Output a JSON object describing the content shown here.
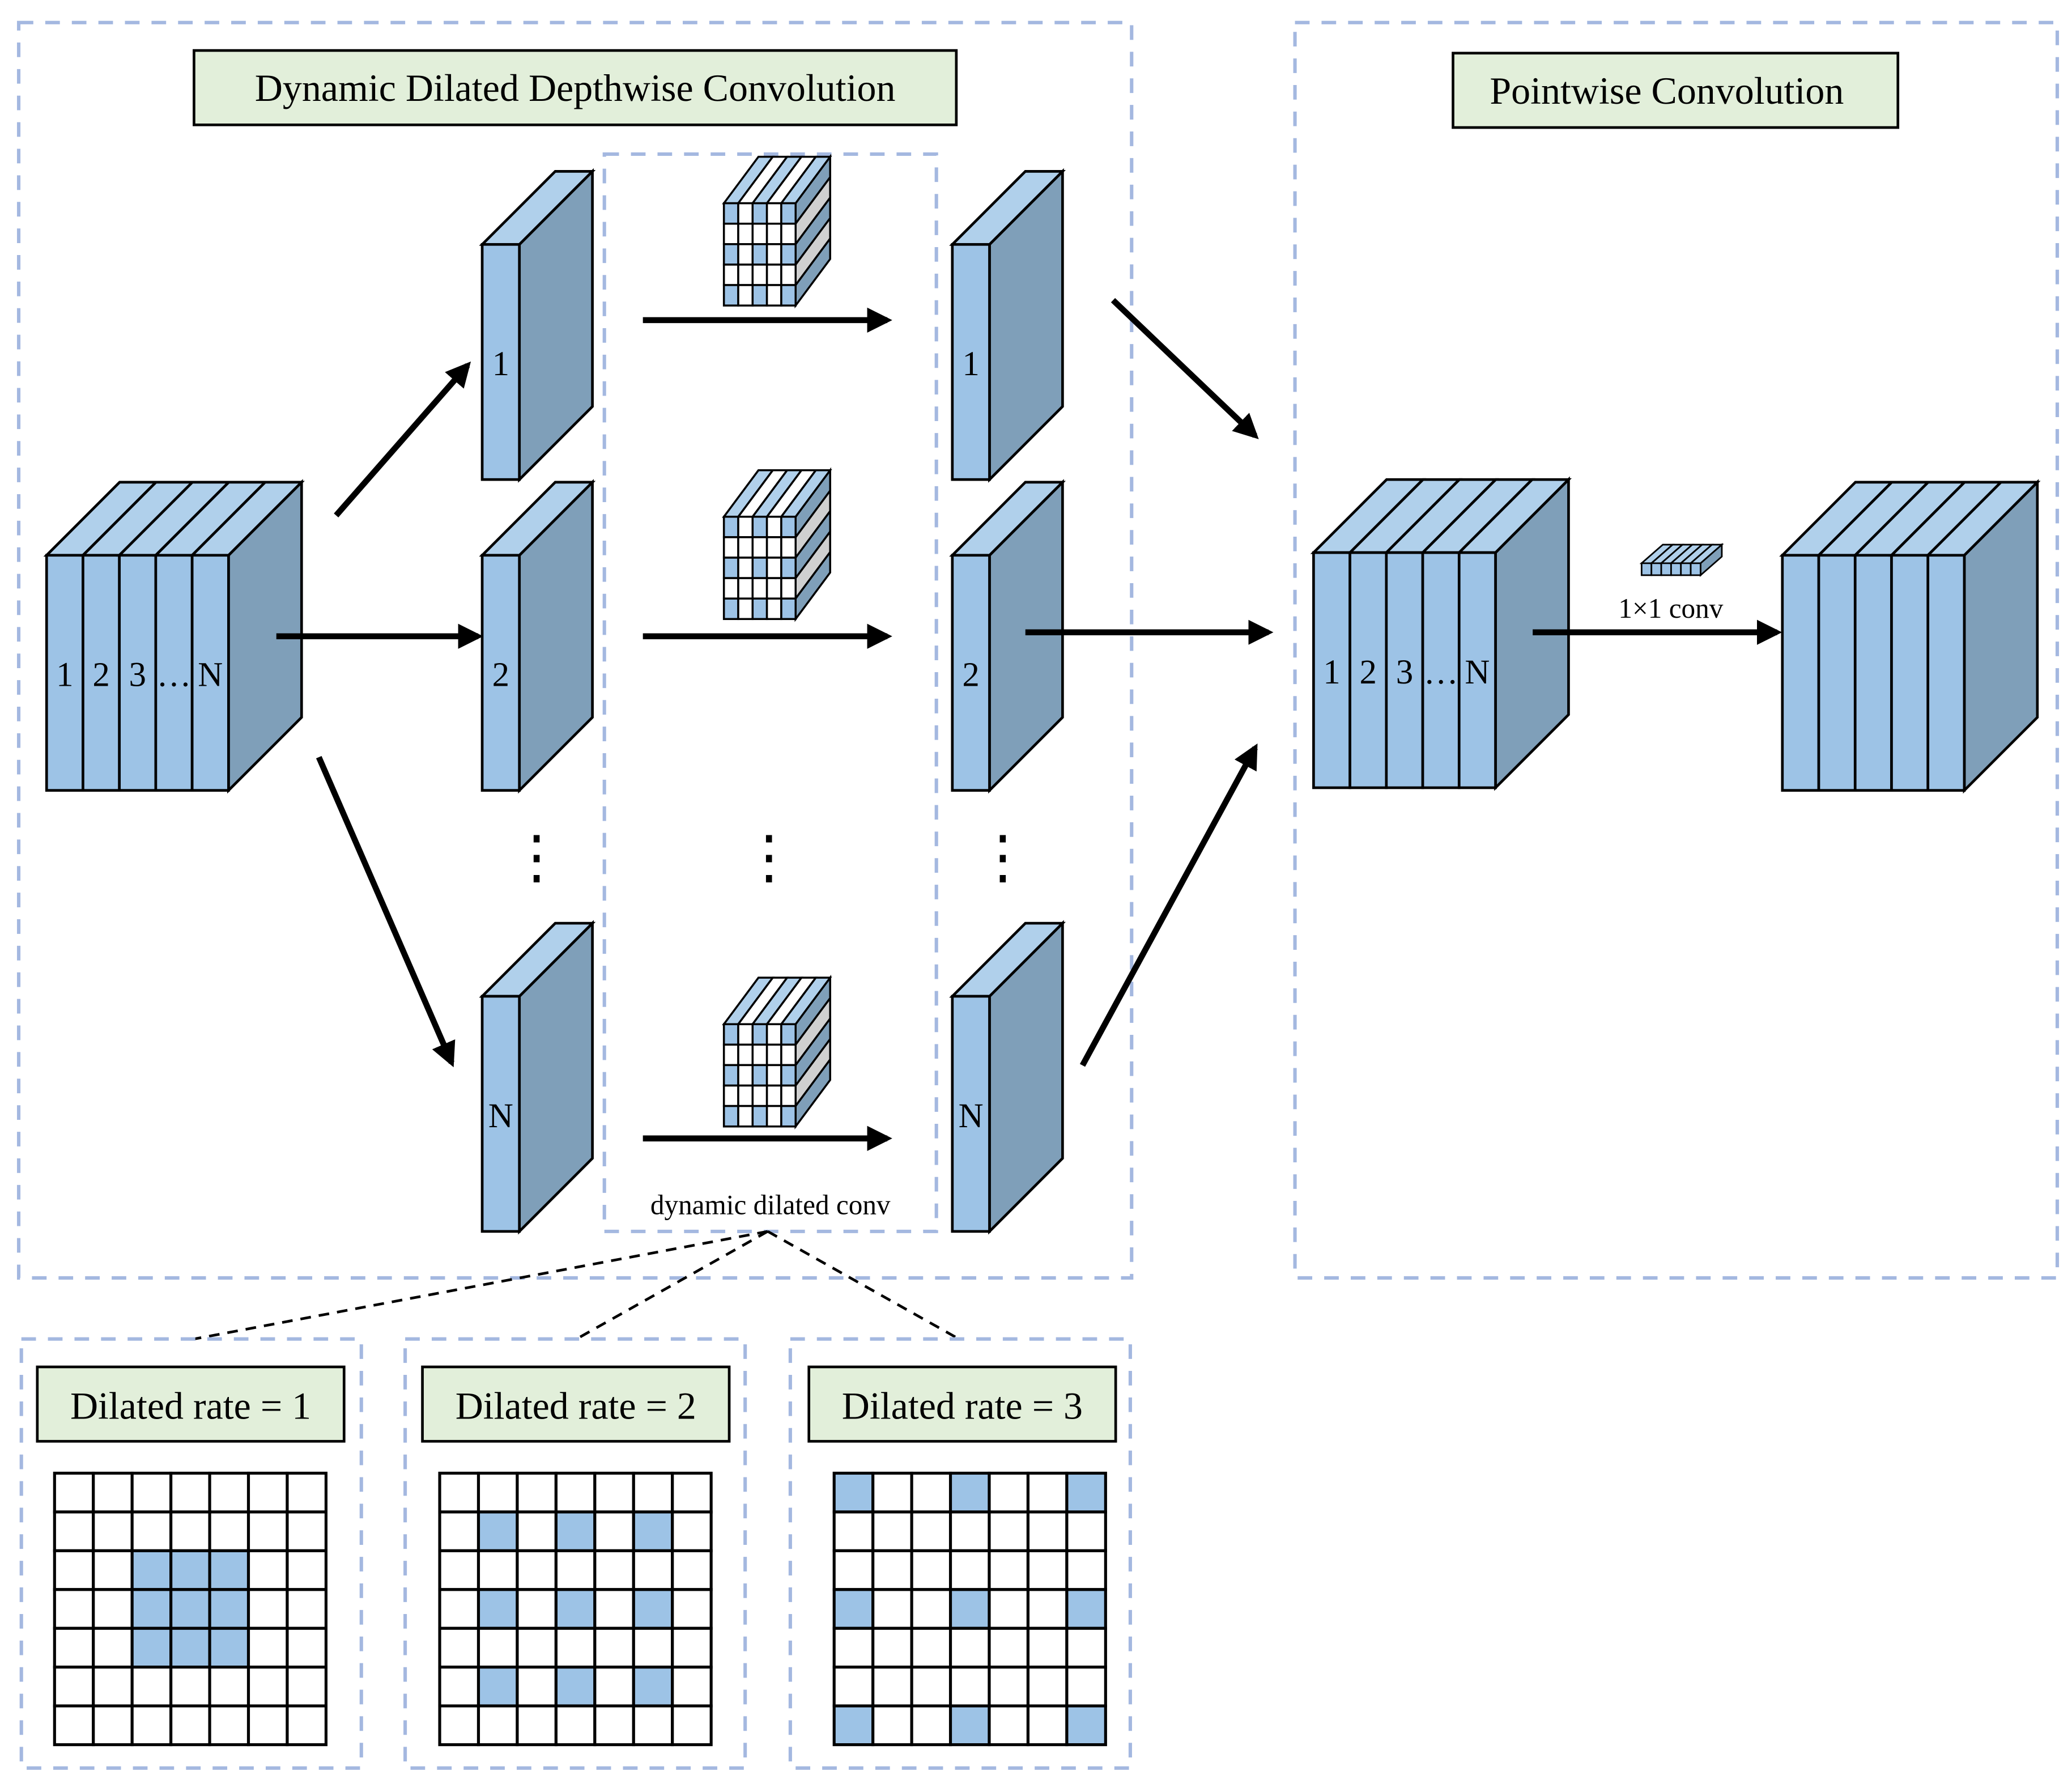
{
  "colors": {
    "feature_front": "#9dc3e6",
    "feature_top": "#b0d0eb",
    "feature_side": "#7f9fb9",
    "kernel_stripe_gray": "#d0d0d0",
    "title_box_fill": "#e2efda",
    "dashed_border": "#a4b8e0",
    "highlight_cell": "#9dc3e6",
    "empty_cell": "#ffffff"
  },
  "depthwise": {
    "title": "Dynamic Dilated Depthwise Convolution",
    "input_cube_labels": [
      "1",
      "2",
      "3",
      "…",
      "N"
    ],
    "channel_labels": [
      "1",
      "2",
      "N"
    ],
    "output_channel_labels": [
      "1",
      "2",
      "N"
    ],
    "ellipsis": "⋮",
    "kernel_label": "dynamic dilated conv"
  },
  "pointwise": {
    "title": "Pointwise Convolution",
    "input_cube_labels": [
      "1",
      "2",
      "3",
      "…",
      "N"
    ],
    "conv_label": "1×1 conv"
  },
  "dilation_examples": [
    {
      "title": "Dilated rate = 1",
      "rate": 1,
      "grid_size": 7,
      "highlighted": [
        [
          2,
          2
        ],
        [
          2,
          3
        ],
        [
          2,
          4
        ],
        [
          3,
          2
        ],
        [
          3,
          3
        ],
        [
          3,
          4
        ],
        [
          4,
          2
        ],
        [
          4,
          3
        ],
        [
          4,
          4
        ]
      ]
    },
    {
      "title": "Dilated rate = 2",
      "rate": 2,
      "grid_size": 7,
      "highlighted": [
        [
          1,
          1
        ],
        [
          1,
          3
        ],
        [
          1,
          5
        ],
        [
          3,
          1
        ],
        [
          3,
          3
        ],
        [
          3,
          5
        ],
        [
          5,
          1
        ],
        [
          5,
          3
        ],
        [
          5,
          5
        ]
      ]
    },
    {
      "title": "Dilated rate = 3",
      "rate": 3,
      "grid_size": 7,
      "highlighted": [
        [
          0,
          0
        ],
        [
          0,
          3
        ],
        [
          0,
          6
        ],
        [
          3,
          0
        ],
        [
          3,
          3
        ],
        [
          3,
          6
        ],
        [
          6,
          0
        ],
        [
          6,
          3
        ],
        [
          6,
          6
        ]
      ]
    }
  ],
  "kernel_pattern": {
    "grid_size": 5,
    "highlighted": [
      [
        0,
        0
      ],
      [
        0,
        2
      ],
      [
        0,
        4
      ],
      [
        2,
        0
      ],
      [
        2,
        2
      ],
      [
        2,
        4
      ],
      [
        4,
        0
      ],
      [
        4,
        2
      ],
      [
        4,
        4
      ]
    ]
  }
}
